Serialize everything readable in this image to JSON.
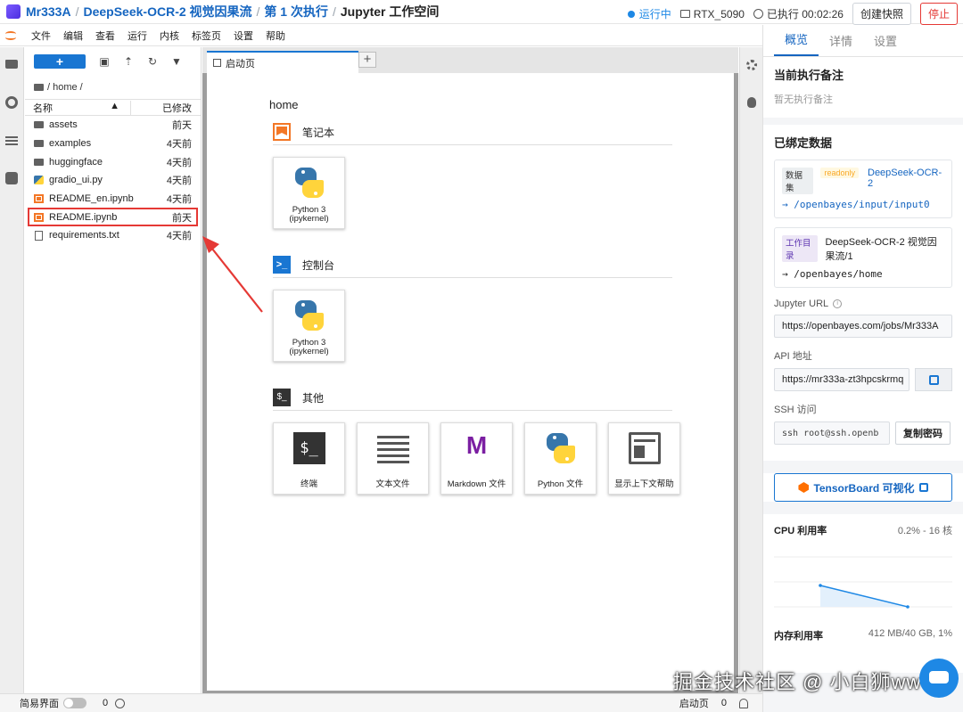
{
  "header": {
    "breadcrumbs": [
      {
        "label": "Mr333A",
        "link": true
      },
      {
        "label": "DeepSeek-OCR-2 视觉因果流",
        "link": true
      },
      {
        "label": "第 1 次执行",
        "link": true
      },
      {
        "label": "Jupyter 工作空间",
        "link": false
      }
    ],
    "status": "运行中",
    "gpu": "RTX_5090",
    "elapsed": "已执行 00:02:26",
    "snapshot_button": "创建快照",
    "stop_button": "停止",
    "status_color": "#1e88e5"
  },
  "menu": [
    "文件",
    "编辑",
    "查看",
    "运行",
    "内核",
    "标签页",
    "设置",
    "帮助"
  ],
  "filebrowser": {
    "new_button": "+",
    "path": "/ home /",
    "col_name": "名称",
    "col_modified": "已修改",
    "files": [
      {
        "name": "assets",
        "modified": "前天",
        "type": "folder"
      },
      {
        "name": "examples",
        "modified": "4天前",
        "type": "folder"
      },
      {
        "name": "huggingface",
        "modified": "4天前",
        "type": "folder"
      },
      {
        "name": "gradio_ui.py",
        "modified": "4天前",
        "type": "python"
      },
      {
        "name": "README_en.ipynb",
        "modified": "4天前",
        "type": "notebook"
      },
      {
        "name": "README.ipynb",
        "modified": "前天",
        "type": "notebook",
        "selected": true
      },
      {
        "name": "requirements.txt",
        "modified": "4天前",
        "type": "text"
      }
    ]
  },
  "tab": {
    "label": "启动页",
    "add": "+"
  },
  "launcher": {
    "path": "home",
    "sections": [
      {
        "title": "笔记本",
        "icon": "notebook-icon",
        "cards": [
          {
            "label": "Python 3 (ipykernel)",
            "art": "python"
          }
        ]
      },
      {
        "title": "控制台",
        "icon": "console-icon",
        "icon_text": ">_",
        "cards": [
          {
            "label": "Python 3 (ipykernel)",
            "art": "python"
          }
        ]
      },
      {
        "title": "其他",
        "icon": "terminal-icon",
        "icon_text": "$_",
        "cards": [
          {
            "label": "终端",
            "art": "terminal",
            "art_text": "$_"
          },
          {
            "label": "文本文件",
            "art": "text"
          },
          {
            "label": "Markdown 文件",
            "art": "markdown",
            "art_text": "M"
          },
          {
            "label": "Python 文件",
            "art": "python"
          },
          {
            "label": "显示上下文帮助",
            "art": "help"
          }
        ]
      }
    ]
  },
  "statusbar": {
    "simple_mode": "简易界面",
    "count_left": "0",
    "tab_name": "启动页",
    "count_right": "0"
  },
  "panel": {
    "tabs": [
      "概览",
      "详情",
      "设置"
    ],
    "note_title": "当前执行备注",
    "note_empty": "暂无执行备注",
    "bound_title": "已绑定数据",
    "dataset_tag": "数据集",
    "readonly_tag": "readonly",
    "dataset_name": "DeepSeek-OCR-2",
    "dataset_mount": "/openbayes/input/input0",
    "workdir_tag": "工作目录",
    "workdir_name": "DeepSeek-OCR-2 视觉因果流/1",
    "workdir_mount": "/openbayes/home",
    "jupyter_url_label": "Jupyter URL",
    "jupyter_url": "https://openbayes.com/jobs/Mr333A",
    "api_label": "API 地址",
    "api_url": "https://mr333a-zt3hpcskrmq",
    "ssh_label": "SSH 访问",
    "ssh_value": "ssh root@ssh.openb",
    "copy_password": "复制密码",
    "tensorboard": "TensorBoard 可视化",
    "cpu_label": "CPU 利用率",
    "cpu_value": "0.2% - 16 核",
    "mem_label": "内存利用率",
    "mem_value": "412 MB/40 GB, 1%"
  },
  "watermark": "掘金技术社区 @ 小白狮ww"
}
